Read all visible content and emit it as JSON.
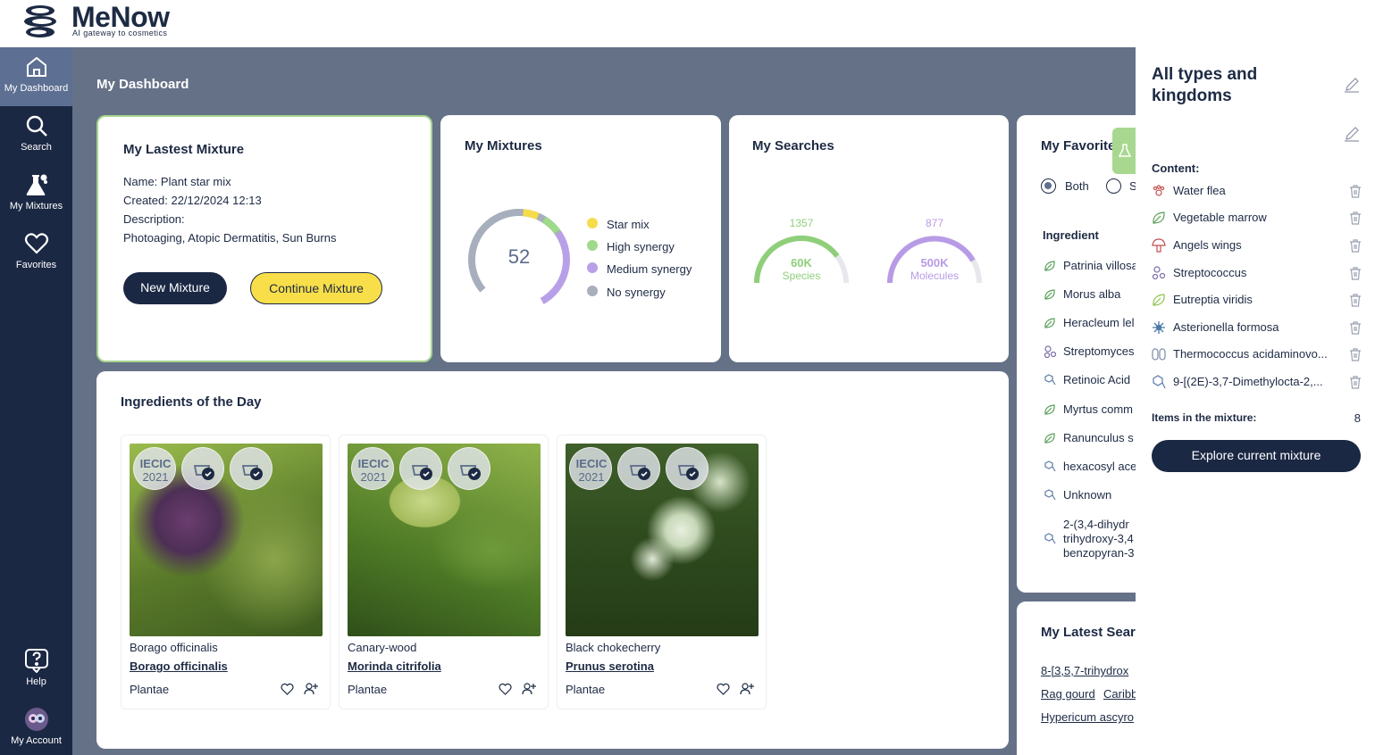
{
  "brand": {
    "name": "MeNow",
    "tagline": "AI gateway to cosmetics"
  },
  "sidebar": {
    "items": [
      {
        "label": "My Dashboard",
        "icon": "home-icon",
        "active": true
      },
      {
        "label": "Search",
        "icon": "search-icon"
      },
      {
        "label": "My Mixtures",
        "icon": "flask-icon"
      },
      {
        "label": "Favorites",
        "icon": "heart-icon"
      }
    ],
    "bottom": [
      {
        "label": "Help",
        "icon": "help-icon"
      },
      {
        "label": "My Account",
        "icon": "avatar-icon"
      }
    ]
  },
  "page_title": "My Dashboard",
  "latest_mixture": {
    "title": "My Lastest Mixture",
    "name": "Name: Plant star mix",
    "created": "Created: 22/12/2024 12:13",
    "description_label": "Description:",
    "description": "Photoaging, Atopic Dermatitis, Sun Burns",
    "new_button": "New Mixture",
    "continue_button": "Continue Mixture"
  },
  "mixtures": {
    "title": "My Mixtures",
    "total": "52",
    "legend": [
      {
        "label": "Star mix",
        "color": "#f5dc4a"
      },
      {
        "label": "High synergy",
        "color": "#9fd98a"
      },
      {
        "label": "Medium synergy",
        "color": "#b8a0e8"
      },
      {
        "label": "No synergy",
        "color": "#a7afbc"
      }
    ]
  },
  "searches": {
    "title": "My Searches",
    "gauges": [
      {
        "count": "1357",
        "total": "60K",
        "unit": "Species",
        "color": "#8fcf7a",
        "fraction": 0.72
      },
      {
        "count": "877",
        "total": "500K",
        "unit": "Molecules",
        "color": "#b89be6",
        "fraction": 0.78
      }
    ]
  },
  "favorites": {
    "title": "My Favorite",
    "radio_both": "Both",
    "radio_second": "S",
    "column_header": "Ingredient",
    "items": [
      {
        "label": "Patrinia villosa",
        "icon": "leaf-icon"
      },
      {
        "label": "Morus alba",
        "icon": "leaf-icon"
      },
      {
        "label": "Heracleum lel",
        "icon": "leaf-icon"
      },
      {
        "label": "Streptomyces",
        "icon": "bacteria-icon"
      },
      {
        "label": "Retinoic Acid",
        "icon": "molecule-icon"
      },
      {
        "label": "Myrtus comm",
        "icon": "leaf-icon"
      },
      {
        "label": "Ranunculus s",
        "icon": "leaf-icon"
      },
      {
        "label": "hexacosyl ace",
        "icon": "molecule-icon"
      },
      {
        "label": "Unknown",
        "icon": "molecule-icon"
      }
    ],
    "multi_item": {
      "lines": [
        "2-(3,4-dihydr",
        "trihydroxy-3,4",
        "benzopyran-3"
      ],
      "icon": "molecule-icon"
    }
  },
  "latest_searches": {
    "title": "My Latest Searc",
    "items": [
      "8-[3,5,7-trihydrox",
      "Rag gourd",
      "Caribb",
      "Hypericum ascyro"
    ]
  },
  "ingredients_of_day": {
    "title": "Ingredients of the Day",
    "badge_iecic": "IECIC",
    "badge_year": "2021",
    "cards": [
      {
        "common": "Borago officinalis",
        "scientific": "Borago officinalis",
        "kingdom": "Plantae"
      },
      {
        "common": "Canary-wood",
        "scientific": "Morinda citrifolia",
        "kingdom": "Plantae"
      },
      {
        "common": "Black chokecherry",
        "scientific": "Prunus serotina",
        "kingdom": "Plantae"
      }
    ]
  },
  "right_panel": {
    "title_line1": "All types and",
    "title_line2": "kingdoms",
    "content_label": "Content:",
    "items": [
      {
        "label": "Water flea",
        "icon": "paw-icon"
      },
      {
        "label": "Vegetable marrow",
        "icon": "leaf-icon"
      },
      {
        "label": "Angels wings",
        "icon": "mushroom-icon"
      },
      {
        "label": "Streptococcus",
        "icon": "bacteria-icon"
      },
      {
        "label": "Eutreptia viridis",
        "icon": "leaf-icon"
      },
      {
        "label": "Asterionella formosa",
        "icon": "alga-icon"
      },
      {
        "label": "Thermococcus acidaminovo...",
        "icon": "archaea-icon"
      },
      {
        "label": "9-[(2E)-3,7-Dimethylocta-2,...",
        "icon": "molecule-icon"
      }
    ],
    "items_label": "Items in the mixture:",
    "items_count": "8",
    "explore_button": "Explore current mixture"
  }
}
